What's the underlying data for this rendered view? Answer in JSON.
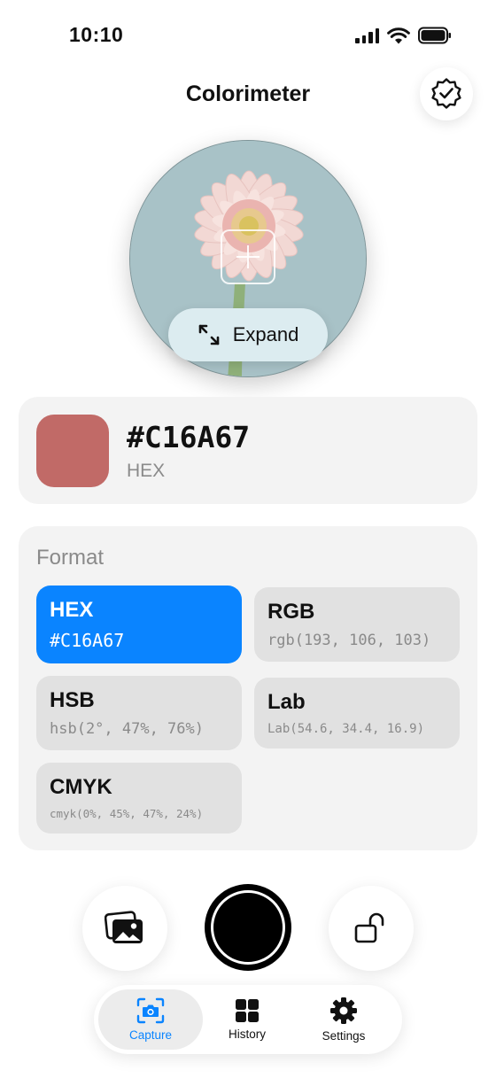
{
  "status_bar": {
    "time": "10:10"
  },
  "header": {
    "title": "Colorimeter"
  },
  "viewfinder": {
    "expand_label": "Expand"
  },
  "current_color": {
    "hex": "#C16A67",
    "format_label": "HEX",
    "swatch_color": "#C16A67"
  },
  "formats": {
    "title": "Format",
    "items": [
      {
        "name": "HEX",
        "value": "#C16A67",
        "selected": true
      },
      {
        "name": "RGB",
        "value": "rgb(193, 106, 103)",
        "selected": false
      },
      {
        "name": "HSB",
        "value": "hsb(2°, 47%, 76%)",
        "selected": false
      },
      {
        "name": "Lab",
        "value": "Lab(54.6, 34.4, 16.9)",
        "selected": false
      },
      {
        "name": "CMYK",
        "value": "cmyk(0%, 45%, 47%, 24%)",
        "selected": false
      }
    ]
  },
  "controls": {
    "gallery_icon": "photos-icon",
    "shutter_icon": "shutter-icon",
    "lock_icon": "lock-open-icon"
  },
  "tab_bar": {
    "tabs": [
      {
        "label": "Capture",
        "icon": "camera-viewfinder-icon",
        "active": true
      },
      {
        "label": "History",
        "icon": "grid-icon",
        "active": false
      },
      {
        "label": "Settings",
        "icon": "gear-icon",
        "active": false
      }
    ]
  },
  "colors": {
    "accent": "#0A84FF",
    "card_background": "#F3F3F3",
    "chip_background": "#E1E1E1"
  }
}
